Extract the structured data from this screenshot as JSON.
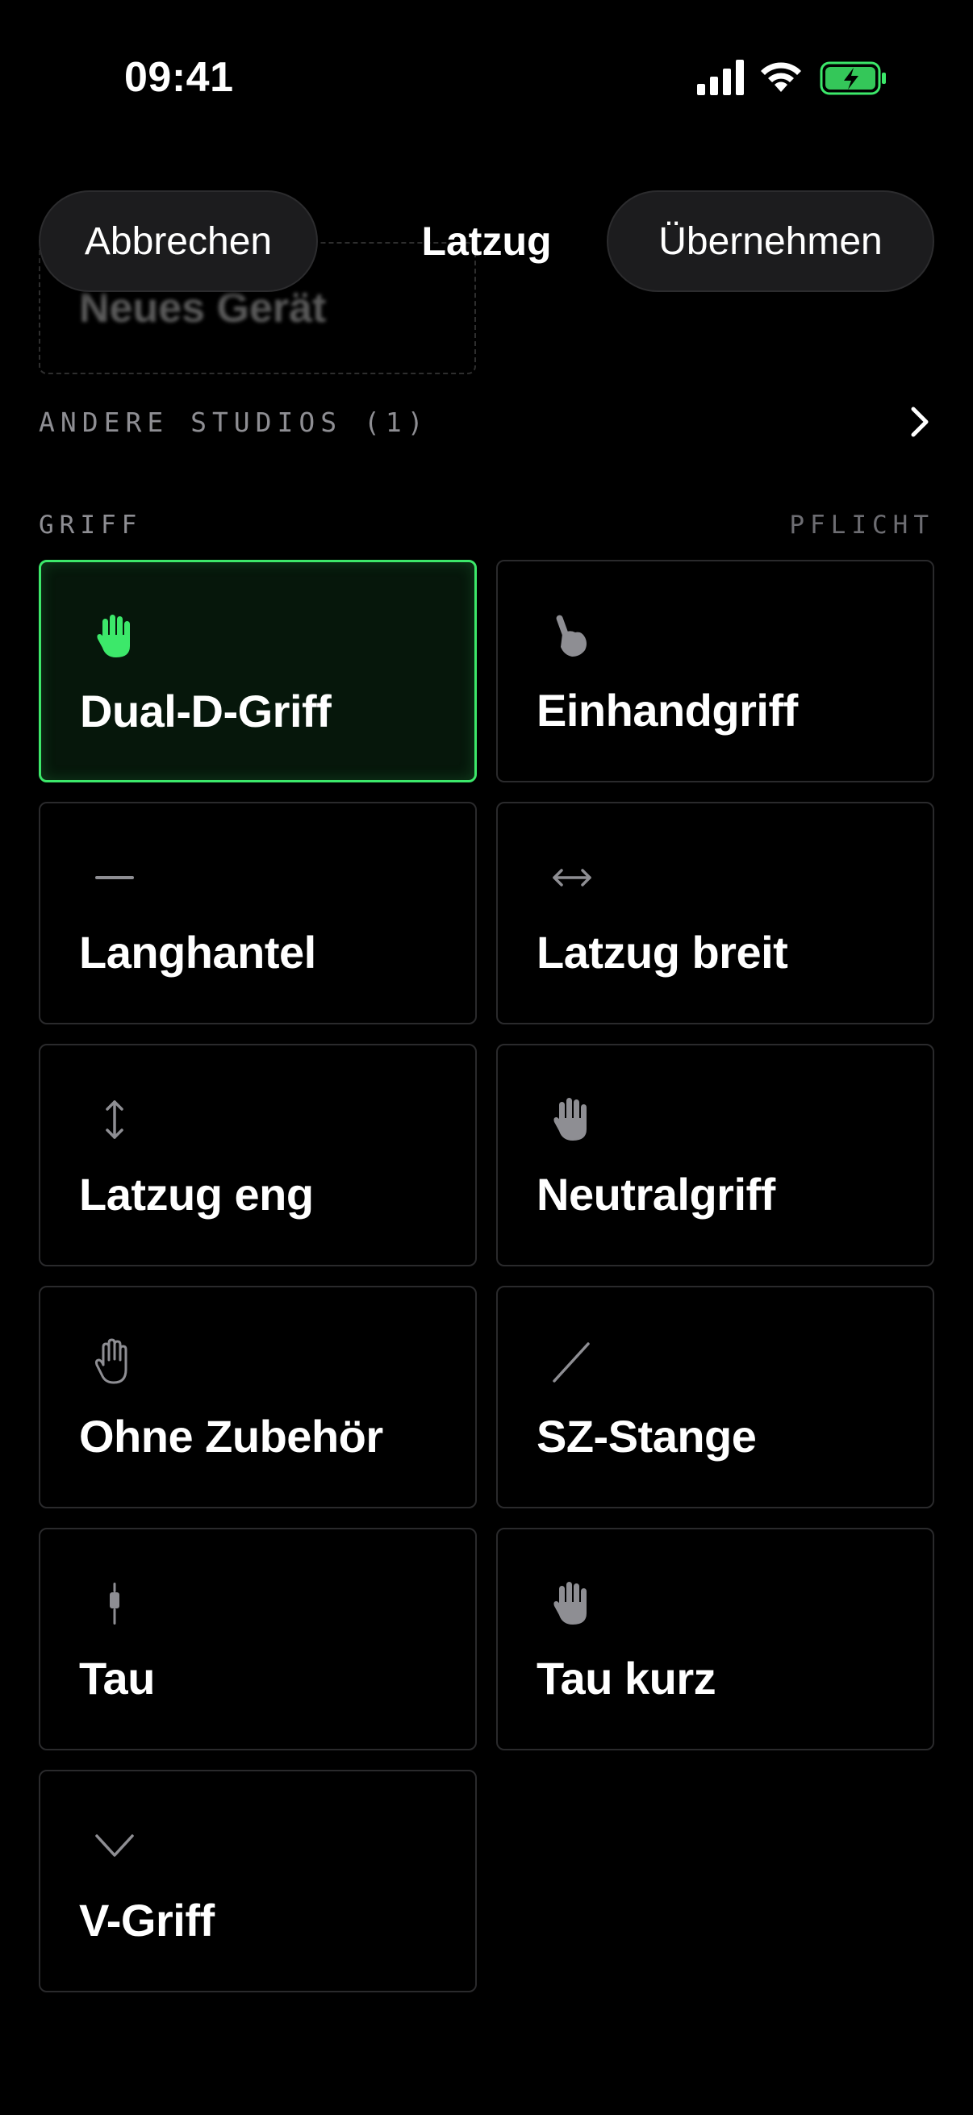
{
  "status_bar": {
    "time": "09:41"
  },
  "header": {
    "cancel_label": "Abbrechen",
    "title": "Latzug",
    "apply_label": "Übernehmen"
  },
  "ghost": {
    "label": "Neues Gerät"
  },
  "studios": {
    "label": "ANDERE STUDIOS (1)"
  },
  "section": {
    "title": "GRIFF",
    "required_label": "PFLICHT"
  },
  "colors": {
    "accent": "#3ce86a",
    "card_border": "#2a2a2c",
    "icon_gray": "#8e8e93"
  },
  "grips": [
    {
      "label": "Dual-D-Griff",
      "icon": "hand-icon",
      "selected": true
    },
    {
      "label": "Einhandgriff",
      "icon": "pointing-hand-icon",
      "selected": false
    },
    {
      "label": "Langhantel",
      "icon": "dash-icon",
      "selected": false
    },
    {
      "label": "Latzug breit",
      "icon": "arrows-horizontal-icon",
      "selected": false
    },
    {
      "label": "Latzug eng",
      "icon": "arrows-vertical-icon",
      "selected": false
    },
    {
      "label": "Neutralgriff",
      "icon": "hand-icon",
      "selected": false
    },
    {
      "label": "Ohne Zubehör",
      "icon": "hand-outline-icon",
      "selected": false
    },
    {
      "label": "SZ-Stange",
      "icon": "diagonal-line-icon",
      "selected": false
    },
    {
      "label": "Tau",
      "icon": "rope-icon",
      "selected": false
    },
    {
      "label": "Tau kurz",
      "icon": "hand-icon",
      "selected": false
    },
    {
      "label": "V-Griff",
      "icon": "chevron-down-icon",
      "selected": false
    }
  ]
}
